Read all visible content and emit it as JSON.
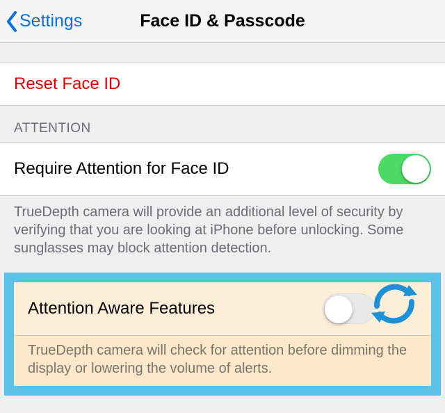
{
  "nav": {
    "back_label": "Settings",
    "title": "Face ID & Passcode"
  },
  "reset": {
    "label": "Reset Face ID"
  },
  "attention_section": {
    "header": "ATTENTION",
    "row": {
      "label": "Require Attention for Face ID",
      "toggle_on": true
    },
    "footer": "TrueDepth camera will provide an additional level of security by verifying that you are looking at iPhone before unlocking. Some sunglasses may block attention detection."
  },
  "aware_section": {
    "row": {
      "label": "Attention Aware Features",
      "toggle_on": false
    },
    "footer": "TrueDepth camera will check for attention before dimming the display or lowering the volume of alerts."
  },
  "colors": {
    "link": "#0071E7",
    "destructive": "#E10000",
    "switch_on": "#4cd964",
    "highlight_border": "#5cc3e8",
    "highlight_fill": "#fce8cb"
  }
}
